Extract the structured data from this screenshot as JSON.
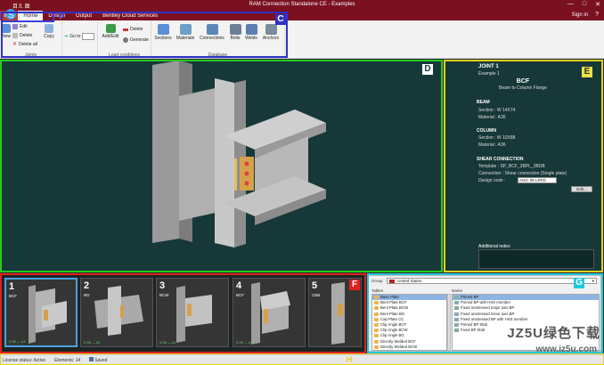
{
  "window": {
    "title": "RAM Connection Standalone CE - Examples",
    "quick_access": "目え 面",
    "controls": [
      "—",
      "□",
      "✕"
    ]
  },
  "menubar": {
    "file_tab": "File",
    "tabs": [
      "Home",
      "Design",
      "Output",
      "Bentley Cloud Services"
    ],
    "active_tab": "Home",
    "sign_in": "Sign in",
    "help_icon": "help-icon"
  },
  "ribbon": {
    "joints_group": {
      "label": "Joints",
      "new": "New",
      "edit": "Edit",
      "delete": "Delete",
      "delete_all": "Delete all",
      "copy": "Copy",
      "go_to": "Go to"
    },
    "load_conditions_group": {
      "label": "Load conditions",
      "add_edit": "Add/Edit",
      "delete": "Delete",
      "generate": "Generate"
    },
    "database_group": {
      "label": "Database",
      "sections": "Sections",
      "materials": "Materials",
      "connections": "Connections",
      "bolts": "Bolts",
      "welds": "Welds",
      "anchors": "Anchors"
    }
  },
  "annotations": {
    "B": "B",
    "C": "C",
    "D": "D",
    "E": "E",
    "F": "F",
    "G": "G",
    "H": "H",
    "colors": {
      "B": "#3d3dd9",
      "C": "#3030c8",
      "D": "#22cc22",
      "E": "#e0d020",
      "F": "#e02020",
      "G": "#22c8e0",
      "H": "#e8d020"
    }
  },
  "properties": {
    "joint": "JOINT 1",
    "example": "Example 1",
    "type_code": "BCF",
    "type_desc": "Beam to Column Flange",
    "beam_head": "BEAM",
    "beam_section": "Section : W 14X74",
    "beam_material": "Material : A36",
    "column_head": "COLUMN",
    "column_section": "Section : W 10X88",
    "column_material": "Material : A36",
    "shear_head": "SHEAR CONNECTION",
    "template": "Template : SP_BCF_3BPL_3BDB",
    "connection": "Connection : Shear connection (Single plate)",
    "design_code_label": "Design code :",
    "design_code_value": "AISC 05 LRFD",
    "edit_button": "Edit...",
    "notes_label": "Additional notes"
  },
  "thumbnails": [
    {
      "num": "1",
      "code": "BCF",
      "footer": "0.98 — A1"
    },
    {
      "num": "2",
      "code": "BG",
      "footer": "0.98 — A1"
    },
    {
      "num": "3",
      "code": "BCW",
      "footer": "0.98 — A1"
    },
    {
      "num": "4",
      "code": "BCF",
      "footer": "0.98 — A1"
    },
    {
      "num": "5",
      "code": "CBB",
      "footer": ""
    }
  ],
  "library": {
    "group_label": "Group",
    "group_value": "United States",
    "tables_label": "Tables",
    "name_label": "Name",
    "tables": [
      "Base Plate",
      "Bent Plate BCF",
      "Bent Plate BCW",
      "Bent Plate BG",
      "Cap Plate CC",
      "Clip Angle BCF",
      "Clip Angle BCW",
      "Clip Angle BG",
      "Directly Welded BCF",
      "Directly Welded BCW"
    ],
    "names": [
      "Pinned BP",
      "Pinned BP with HSS member",
      "Fixed unstressed major axis BP",
      "Fixed unstressed minor axis BP",
      "Fixed unstressed BP with HSS member",
      "Pinned BP Slab",
      "Fixed BP Slab"
    ]
  },
  "statusbar": {
    "license": "License status: Active",
    "elements": "Elements: 14",
    "saved": "Saved"
  },
  "watermark": {
    "site": "JZ5U绿色下载",
    "url": "www.jz5u.com",
    "logo_url": "www.pc0359.cn"
  }
}
